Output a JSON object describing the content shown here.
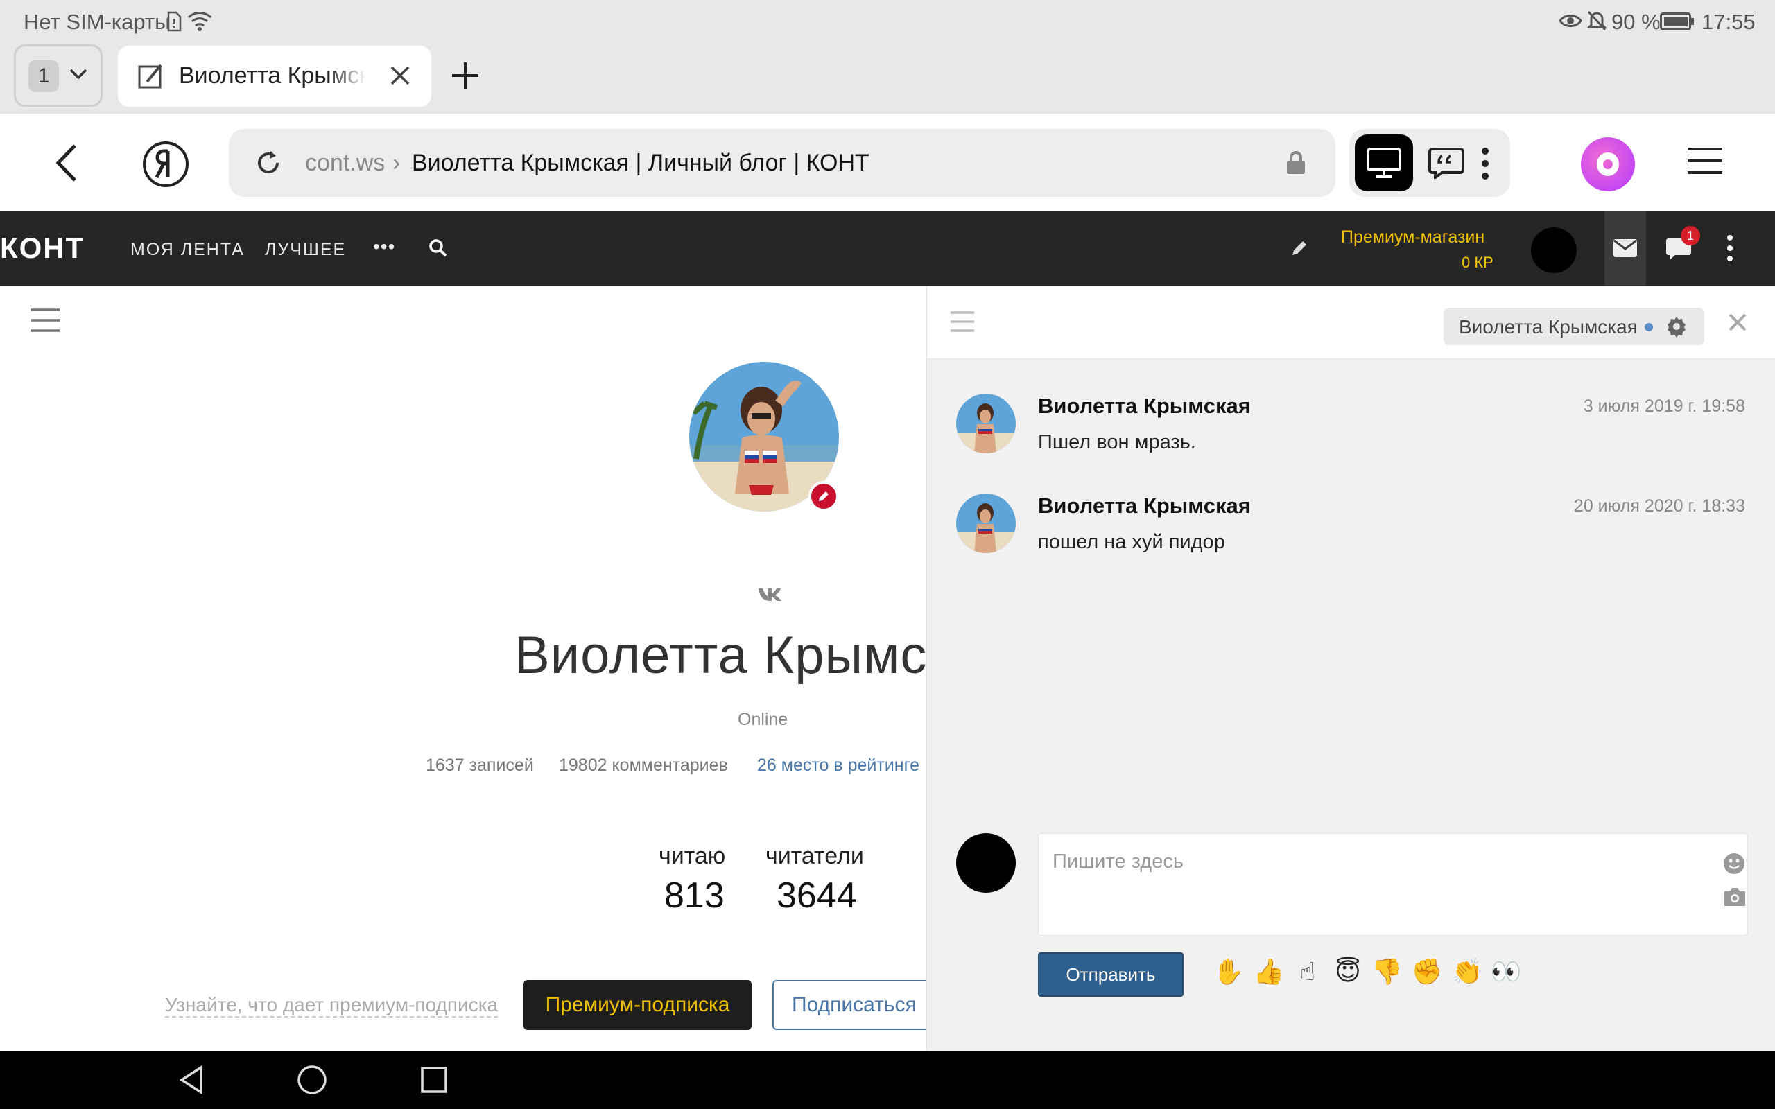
{
  "status_bar": {
    "carrier": "Нет SIM-карты",
    "battery": "90 %",
    "time": "17:55"
  },
  "tabs": {
    "count": "1",
    "active_title": "Виолетта Крымская | Личный блог | КОНТ"
  },
  "address_bar": {
    "host": "cont.ws",
    "separator": "›",
    "page_title": "Виолетта Крымская | Личный блог | КОНТ"
  },
  "site_header": {
    "logo": "КОНТ",
    "nav": [
      "МОЯ ЛЕНТА",
      "ЛУЧШЕЕ"
    ],
    "more": "•••",
    "premium_shop": "Премиум-магазин",
    "premium_balance": "0 КР",
    "notification_count": "1"
  },
  "profile": {
    "social": "vk",
    "name": "Виолетта Крымская",
    "status": "Online",
    "posts": "1637 записей",
    "comments": "19802 комментариев",
    "rating": "26 место в рейтинге",
    "following_label": "читаю",
    "following_count": "813",
    "followers_label": "читатели",
    "followers_count": "3644",
    "learn_premium": "Узнайте, что дает премиум-подписка",
    "premium_button": "Премиум-подписка",
    "subscribe_button": "Подписаться"
  },
  "chat": {
    "recipient": "Виолетта Крымская",
    "messages": [
      {
        "author": "Виолетта Крымская",
        "date": "3 июля 2019 г. 19:58",
        "text": "Пшел вон  мразь."
      },
      {
        "author": "Виолетта Крымская",
        "date": "20 июля 2020 г. 18:33",
        "text": "пошел на хуй  пидор"
      }
    ],
    "input_placeholder": "Пишите здесь",
    "send_button": "Отправить",
    "reactions": [
      "✋",
      "👍",
      "☝",
      "😇",
      "👎",
      "✊",
      "👏",
      "👀"
    ]
  },
  "colors": {
    "header_bg": "#262626",
    "premium_yellow": "#f2c200",
    "link_blue": "#4a76a8",
    "send_blue": "#2f5f8c",
    "badge_red": "#d3202a"
  }
}
